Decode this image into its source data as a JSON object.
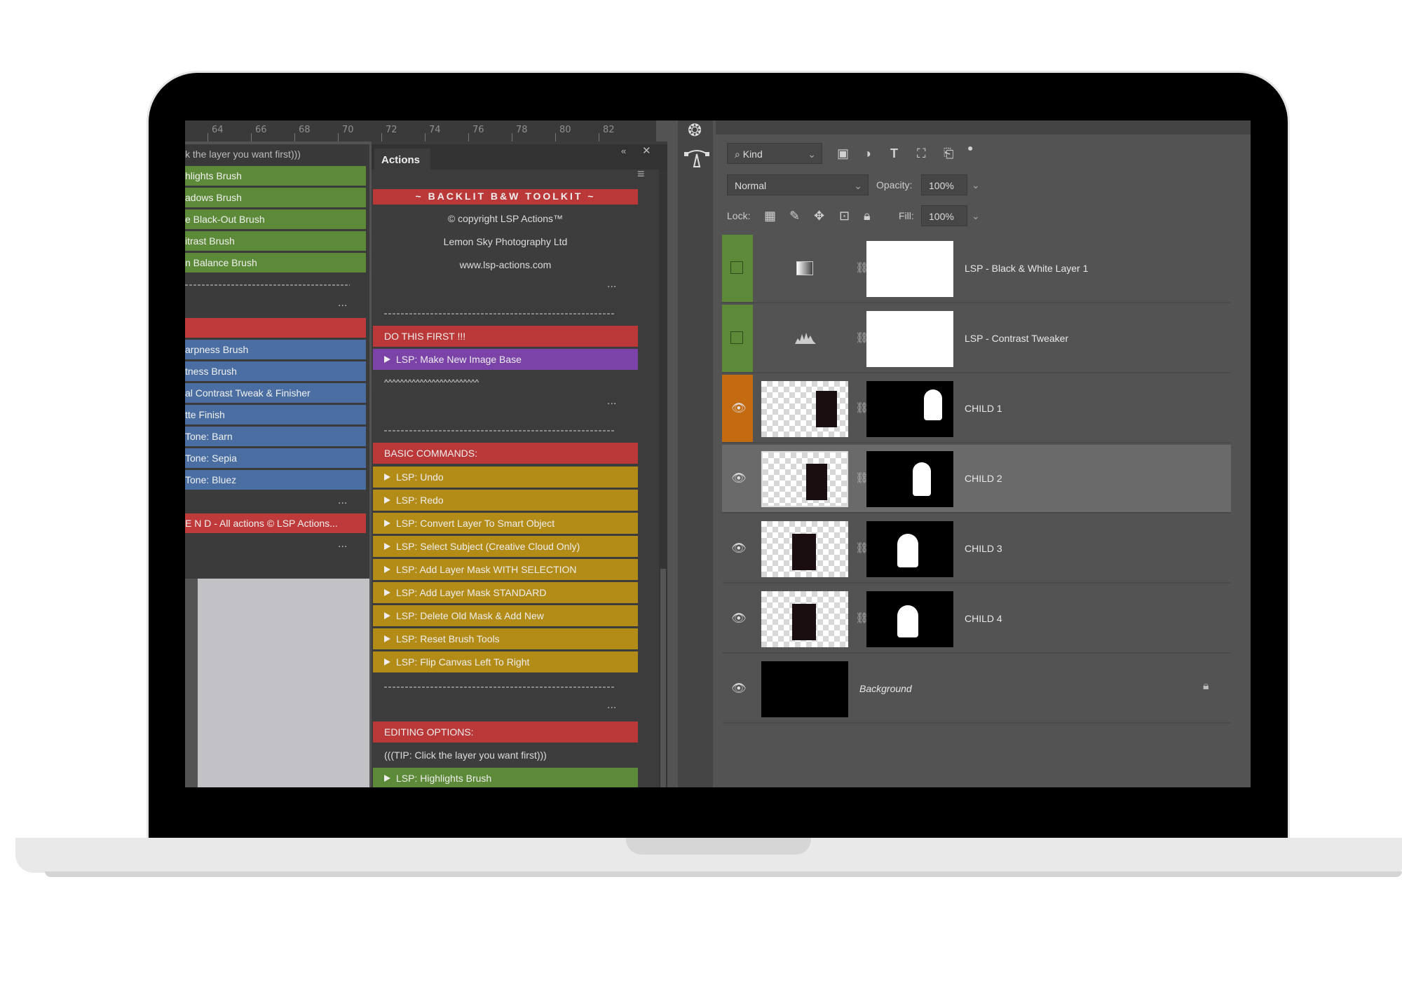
{
  "ruler": [
    "64",
    "66",
    "68",
    "70",
    "72",
    "74",
    "76",
    "78",
    "80",
    "82"
  ],
  "left_panel": {
    "items": [
      {
        "label": "k the layer you want first)))",
        "style": "d"
      },
      {
        "label": "hlights Brush",
        "style": "g"
      },
      {
        "label": "adows Brush",
        "style": "g"
      },
      {
        "label": "e Black-Out Brush",
        "style": "g"
      },
      {
        "label": "itrast Brush",
        "style": "g"
      },
      {
        "label": "n Balance Brush",
        "style": "g"
      },
      {
        "label": "",
        "style": "r"
      },
      {
        "label": "arpness Brush",
        "style": "b"
      },
      {
        "label": "tness Brush",
        "style": "b"
      },
      {
        "label": "al Contrast Tweak & Finisher",
        "style": "b"
      },
      {
        "label": "tte Finish",
        "style": "b"
      },
      {
        "label": "Tone: Barn",
        "style": "b"
      },
      {
        "label": "Tone: Sepia",
        "style": "b"
      },
      {
        "label": "Tone: Bluez",
        "style": "b"
      },
      {
        "label": "E N D - All actions © LSP Actions...",
        "style": "r"
      }
    ],
    "dots": "..."
  },
  "actions": {
    "tab": "Actions",
    "header": "~ BACKLIT B&W TOOLKIT ~",
    "copyright": "© copyright LSP Actions™",
    "company": "Lemon Sky Photography Ltd",
    "website": "www.lsp-actions.com",
    "dots": "...",
    "section1": "DO THIS FIRST !!!",
    "make_base": "LSP: Make New Image Base",
    "wave": "^^^^^^^^^^^^^^^^^^^^^^^^",
    "section2": "BASIC COMMANDS:",
    "basic_commands": [
      "LSP: Undo",
      "LSP: Redo",
      "LSP: Convert Layer To Smart Object",
      "LSP: Select Subject (Creative Cloud Only)",
      "LSP: Add Layer Mask WITH SELECTION",
      "LSP: Add Layer Mask STANDARD",
      "LSP: Delete Old Mask & Add New",
      "LSP: Reset Brush Tools",
      "LSP: Flip Canvas Left To Right"
    ],
    "section3": "EDITING OPTIONS:",
    "tip": "(((TIP: Click the layer you want first)))",
    "highlights": "LSP: Highlights Brush"
  },
  "layers_panel": {
    "kind": "Kind",
    "blend_mode": "Normal",
    "opacity_label": "Opacity:",
    "opacity": "100%",
    "lock_label": "Lock:",
    "fill_label": "Fill:",
    "fill": "100%",
    "layers": [
      {
        "name": "LSP - Black & White Layer 1",
        "type": "adjustment",
        "tag": "#5c8a38",
        "visible": false
      },
      {
        "name": "LSP - Contrast Tweaker",
        "type": "adjustment",
        "tag": "#5c8a38",
        "visible": false
      },
      {
        "name": "CHILD 1",
        "type": "masked",
        "tag": "#c46a10",
        "visible": true
      },
      {
        "name": "CHILD 2",
        "type": "masked",
        "tag": "",
        "visible": true,
        "selected": true
      },
      {
        "name": "CHILD 3",
        "type": "masked",
        "tag": "",
        "visible": true
      },
      {
        "name": "CHILD 4",
        "type": "masked",
        "tag": "",
        "visible": true
      },
      {
        "name": "Background",
        "type": "background",
        "tag": "",
        "visible": true
      }
    ]
  }
}
